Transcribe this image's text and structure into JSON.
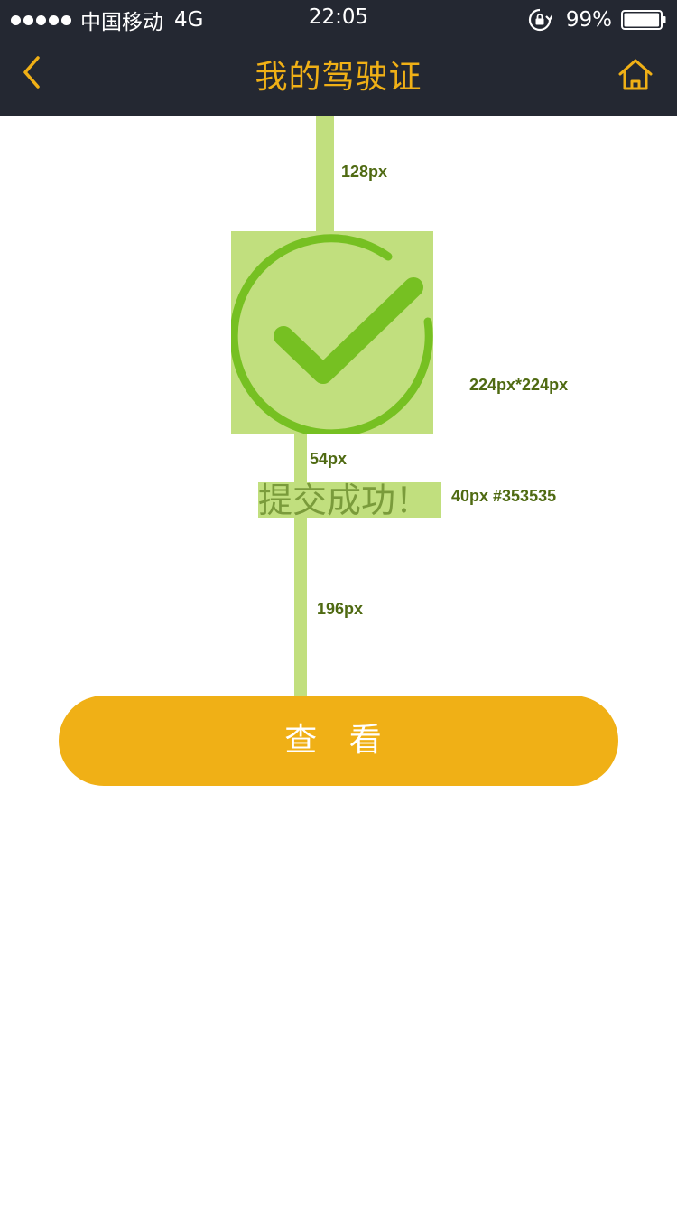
{
  "status_bar": {
    "carrier": "中国移动",
    "network": "4G",
    "time": "22:05",
    "battery": "99%",
    "battery_level": 0.99,
    "icons": [
      "signal-dots-icon",
      "rotation-lock-icon",
      "battery-icon"
    ]
  },
  "nav": {
    "title": "我的驾驶证",
    "back_icon": "chevron-left-icon",
    "home_icon": "home-icon"
  },
  "content": {
    "success_icon": "check-circle-icon",
    "message": "提交成功！",
    "button_label": "查 看"
  },
  "annotations": {
    "top_spacing": "128px",
    "icon_size": "224px*224px",
    "icon_text_spacing": "54px",
    "text_spec": "40px  #353535",
    "text_button_spacing": "196px"
  },
  "colors": {
    "nav_background": "#242832",
    "accent": "#f0b016",
    "success_green": "#76c022",
    "annotation_fill": "#c1df7e",
    "annotation_text": "#4f6a12"
  }
}
